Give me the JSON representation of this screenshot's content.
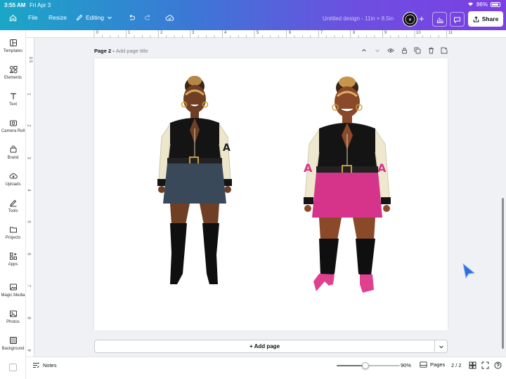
{
  "status": {
    "time": "3:55 AM",
    "date": "Fri Apr 3",
    "battery": "86%"
  },
  "toolbar": {
    "file": "File",
    "resize": "Resize",
    "editing": "Editing",
    "doc_title": "Untitled design - 11in × 8.5in",
    "share": "Share"
  },
  "sidebar": {
    "items": [
      {
        "label": "Templates",
        "icon": "templates-icon"
      },
      {
        "label": "Elements",
        "icon": "elements-icon"
      },
      {
        "label": "Text",
        "icon": "text-icon"
      },
      {
        "label": "Camera Roll",
        "icon": "camera-icon"
      },
      {
        "label": "Brand",
        "icon": "brand-icon"
      },
      {
        "label": "Uploads",
        "icon": "uploads-icon"
      },
      {
        "label": "Tools",
        "icon": "tools-icon"
      },
      {
        "label": "Projects",
        "icon": "projects-icon"
      },
      {
        "label": "Apps",
        "icon": "apps-icon"
      },
      {
        "label": "Magic Media",
        "icon": "magic-media-icon"
      },
      {
        "label": "Photos",
        "icon": "photos-icon"
      },
      {
        "label": "Background",
        "icon": "background-icon"
      }
    ]
  },
  "ruler": {
    "top": [
      "0",
      "1",
      "2",
      "3",
      "4",
      "5",
      "6",
      "7",
      "8",
      "9",
      "10",
      "11"
    ],
    "left": [
      "0.5",
      "1",
      "2",
      "3",
      "4",
      "5",
      "6",
      "7",
      "8",
      "9"
    ]
  },
  "page": {
    "label": "Page 2 - ",
    "title_placeholder": "Add page title"
  },
  "add_page": "+ Add page",
  "bottom": {
    "notes": "Notes",
    "zoom": "90%",
    "zoom_fraction": 0.45,
    "pages": "Pages",
    "page_count": "2 / 2"
  },
  "colors": {
    "accent": "#7b3fe4",
    "skirt_pink": "#d6338a",
    "denim": "#39495a"
  }
}
